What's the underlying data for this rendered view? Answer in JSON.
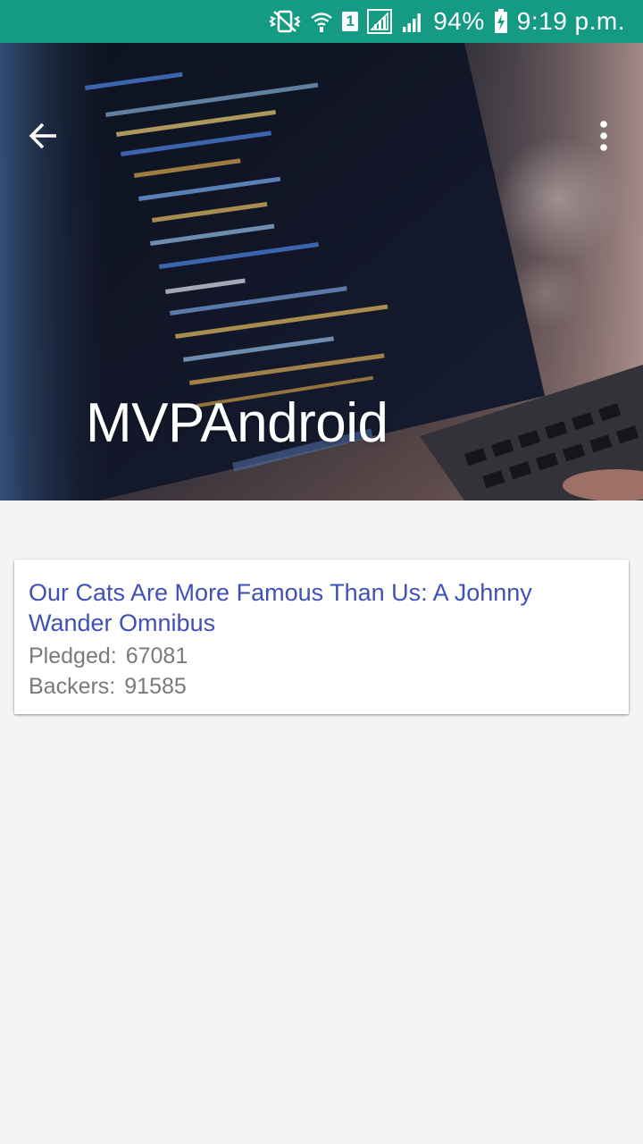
{
  "status_bar": {
    "battery": "94%",
    "time": "9:19 p.m.",
    "sim_slot": "1",
    "bg_color": "#159a84",
    "icons": [
      "vibrate-icon",
      "wifi-icon",
      "sim-icon",
      "signal-icon",
      "signal-icon",
      "battery-charging-icon"
    ]
  },
  "toolbar": {
    "title": "MVPAndroid",
    "back_icon": "arrow-back-icon",
    "more_icon": "more-vert-icon"
  },
  "projects": [
    {
      "title": "Our Cats Are More Famous Than Us: A Johnny Wander Omnibus",
      "pledged_label": "Pledged:",
      "pledged": "67081",
      "backers_label": "Backers:",
      "backers": "91585"
    }
  ],
  "colors": {
    "accent_title": "#3f51b5",
    "secondary_text": "#7a7a7a",
    "background": "#f4f4f4"
  }
}
